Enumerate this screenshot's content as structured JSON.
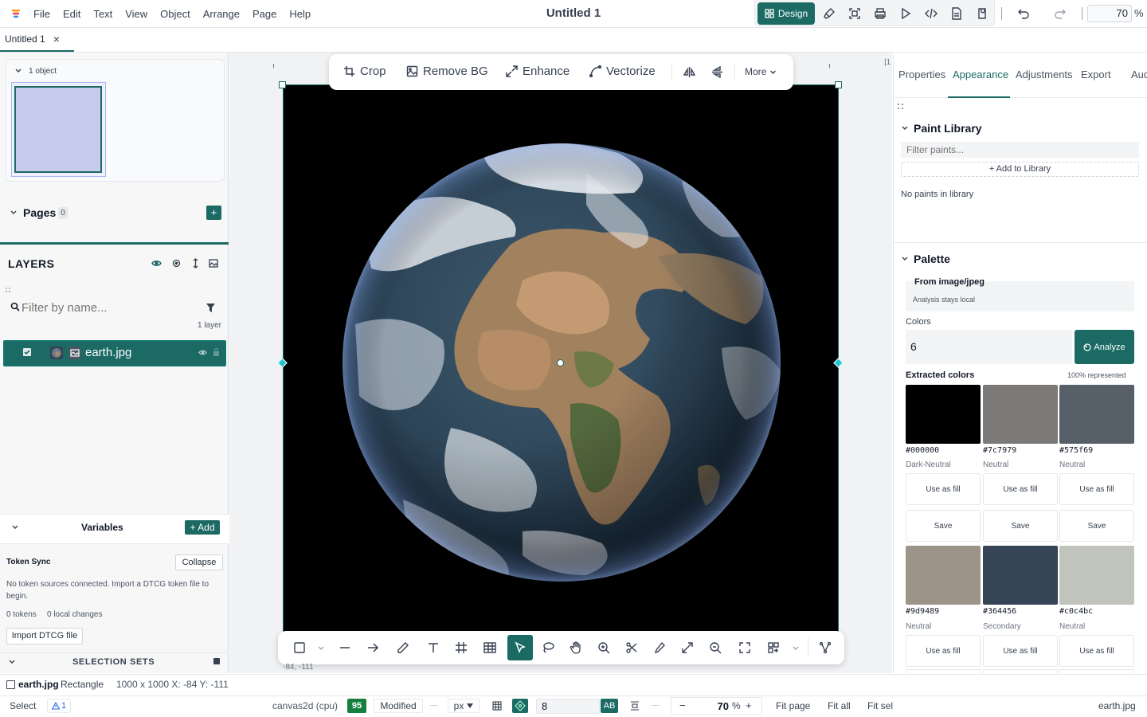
{
  "menubar": {
    "items": [
      "File",
      "Edit",
      "Text",
      "View",
      "Object",
      "Arrange",
      "Page",
      "Help"
    ],
    "doc_title": "Untitled 1",
    "design_label": "Design",
    "zoom_value": "70",
    "zoom_pct": "%",
    "tool_icons": [
      "brush-icon",
      "frame-select-icon",
      "print-icon",
      "play-icon",
      "code-icon",
      "document-icon",
      "plugin-icon",
      "undo-icon",
      "redo-icon"
    ]
  },
  "tabs": {
    "active_label": "Untitled 1",
    "close": "×"
  },
  "left": {
    "object_count_label": "1 object",
    "pages_label": "Pages",
    "pages_count": "0",
    "pages_add": "+",
    "layers_title": "LAYERS",
    "filter_placeholder": "Filter by name...",
    "layer_count": "1 layer",
    "layer_name": "earth.jpg",
    "variables_label": "Variables",
    "variables_add": "+ Add",
    "token_sync_title": "Token Sync",
    "collapse_label": "Collapse",
    "token_sync_desc": "No token sources connected. Import a DTCG token file to begin.",
    "tokens_count": "0 tokens",
    "local_changes": "0 local changes",
    "import_label": "Import DTCG file",
    "selection_sets": "SELECTION SETS"
  },
  "canvas": {
    "ruler_right": "|1",
    "image_toolbar": [
      {
        "label": "Crop",
        "icon": "crop-icon"
      },
      {
        "label": "Remove BG",
        "icon": "image-icon"
      },
      {
        "label": "Enhance",
        "icon": "expand-icon"
      },
      {
        "label": "Vectorize",
        "icon": "pen-curve-icon"
      }
    ],
    "more_label": "More",
    "coords_label": "-84, -111",
    "bottom_tools": [
      "rectangle-icon",
      "chevron-down-icon",
      "line-icon",
      "arrow-icon",
      "pencil-icon",
      "text-icon",
      "frame-icon",
      "table-icon",
      "select-icon",
      "lasso-icon",
      "hand-icon",
      "zoom-in-icon",
      "scissors-icon",
      "eyedropper-icon",
      "resize-icon",
      "zoom-icon",
      "fullscreen-icon",
      "components-icon",
      "chevron-down-icon",
      "vector-network-icon"
    ]
  },
  "right": {
    "tabs": [
      "Properties",
      "Appearance",
      "Adjustments",
      "Export",
      "Audit"
    ],
    "active_tab": "Appearance",
    "paint_library_title": "Paint Library",
    "filter_paints_placeholder": "Filter paints...",
    "add_to_library": "+ Add to Library",
    "no_paints": "No paints in library",
    "palette_title": "Palette",
    "from_image": "From image/jpeg",
    "analysis_local": "Analysis stays local",
    "colors_label": "Colors",
    "colors_value": "6",
    "analyze_label": "Analyze",
    "extracted_label": "Extracted colors",
    "represented": "100% represented",
    "use_as_fill": "Use as fill",
    "save": "Save",
    "swatches": [
      {
        "hex": "#000000",
        "role": "Dark-Neutral",
        "color": "#000000"
      },
      {
        "hex": "#7c7979",
        "role": "Neutral",
        "color": "#7c7979"
      },
      {
        "hex": "#575f69",
        "role": "Neutral",
        "color": "#575f69"
      },
      {
        "hex": "#9d9489",
        "role": "Neutral",
        "color": "#9d9489"
      },
      {
        "hex": "#364456",
        "role": "Secondary",
        "color": "#364456"
      },
      {
        "hex": "#c0c4bc",
        "role": "Neutral",
        "color": "#c0c4bc"
      }
    ]
  },
  "status": {
    "selection_name": "earth.jpg",
    "selection_type": "Rectangle",
    "selection_info": "1000 x 1000 X: -84 Y: -111",
    "mode": "Select",
    "warnings": "1",
    "renderer": "canvas2d (cpu)",
    "score": "95",
    "modified": "Modified",
    "unit": "px",
    "grid_value": "8",
    "ab_label": "AB",
    "zoom_minus": "−",
    "zoom_value": "70",
    "zoom_pct": "%",
    "zoom_plus": "+",
    "fit_page": "Fit page",
    "fit_all": "Fit all",
    "fit_sel": "Fit sel",
    "file_name": "earth.jpg"
  },
  "colors": {
    "accent": "#1b6a64",
    "accent_dark": "#0f766e",
    "panel_bg": "#f7f7f8"
  }
}
